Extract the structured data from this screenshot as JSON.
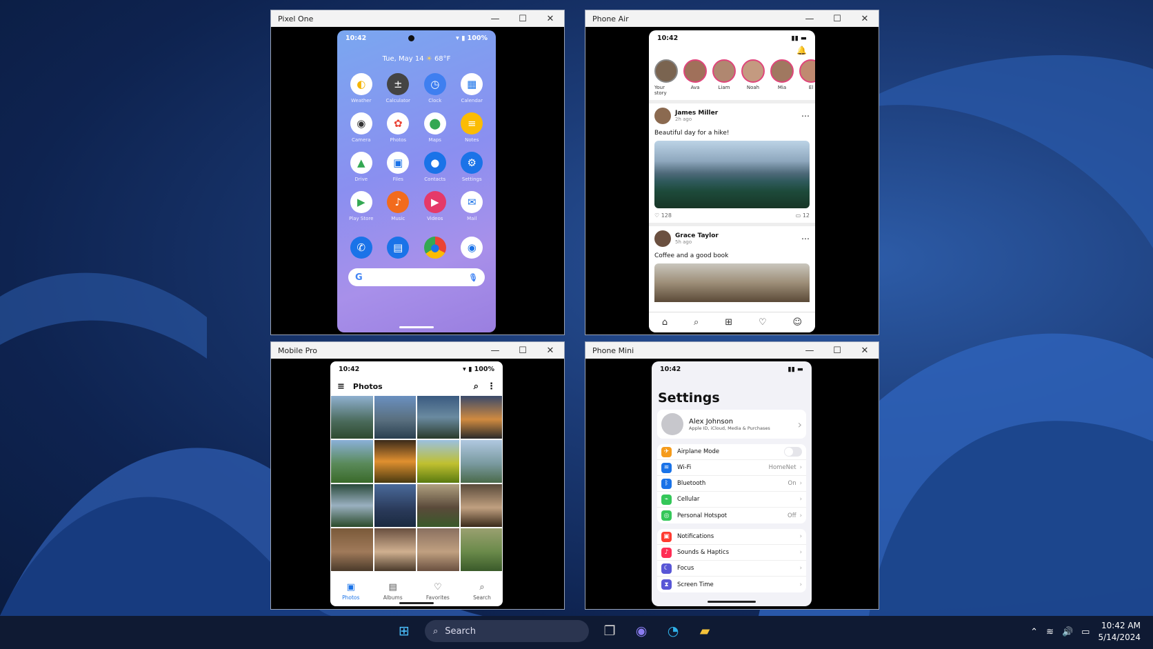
{
  "windows": {
    "pixel": {
      "title": "Pixel One"
    },
    "air": {
      "title": "Phone Air"
    },
    "pro": {
      "title": "Mobile Pro"
    },
    "mini": {
      "title": "Phone Mini"
    }
  },
  "pixel": {
    "time": "10:42",
    "battery": "100%",
    "date": "Tue, May 14",
    "weather": "68°F",
    "apps": [
      "Weather",
      "Calculator",
      "Clock",
      "Calendar",
      "Camera",
      "Photos",
      "Maps",
      "Notes",
      "Drive",
      "Files",
      "Contacts",
      "Settings",
      "Play Store",
      "Music",
      "Videos",
      "Mail"
    ],
    "search_g": "G"
  },
  "air": {
    "time": "10:42",
    "stories": [
      "Your story",
      "Ava",
      "Liam",
      "Noah",
      "Mia",
      "El"
    ],
    "post1": {
      "name": "James Miller",
      "time": "2h ago",
      "text": "Beautiful day for a hike!",
      "likes": "128",
      "comments": "12"
    },
    "post2": {
      "name": "Grace Taylor",
      "time": "5h ago",
      "text": "Coffee and a good book"
    }
  },
  "pro": {
    "time": "10:42",
    "battery": "100%",
    "title": "Photos",
    "nav": [
      "Photos",
      "Albums",
      "Favorites",
      "Search"
    ]
  },
  "mini": {
    "time": "10:42",
    "title": "Settings",
    "account": {
      "name": "Alex Johnson",
      "sub": "Apple ID, iCloud, Media & Purchases"
    },
    "group1": [
      {
        "label": "Airplane Mode",
        "value": ""
      },
      {
        "label": "Wi-Fi",
        "value": "HomeNet"
      },
      {
        "label": "Bluetooth",
        "value": "On"
      },
      {
        "label": "Cellular",
        "value": ""
      },
      {
        "label": "Personal Hotspot",
        "value": "Off"
      }
    ],
    "group2": [
      {
        "label": "Notifications",
        "value": ""
      },
      {
        "label": "Sounds & Haptics",
        "value": ""
      },
      {
        "label": "Focus",
        "value": ""
      },
      {
        "label": "Screen Time",
        "value": ""
      }
    ]
  },
  "taskbar": {
    "search": "Search",
    "time": "10:42 AM",
    "date": "5/14/2024"
  },
  "colors": {
    "accent": "#1a73e8",
    "taskbar": "#0f1a33"
  }
}
